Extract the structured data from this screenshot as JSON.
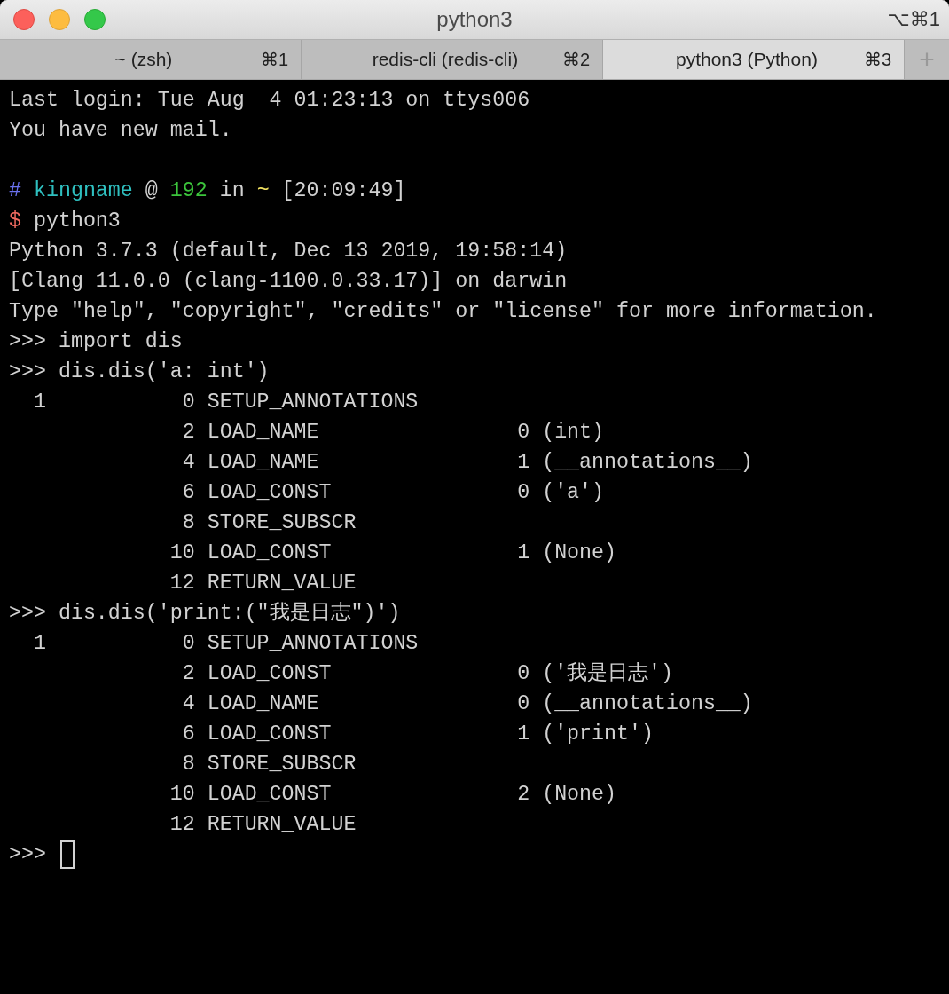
{
  "window": {
    "title": "python3",
    "shortcut": "⌥⌘1"
  },
  "tabs": [
    {
      "label": "~ (zsh)",
      "shortcut": "⌘1",
      "selected": false
    },
    {
      "label": "redis-cli (redis-cli)",
      "shortcut": "⌘2",
      "selected": false
    },
    {
      "label": "python3 (Python)",
      "shortcut": "⌘3",
      "selected": true
    }
  ],
  "new_tab_button": "+",
  "terminal": {
    "lines": [
      {
        "kind": "plain",
        "text": "Last login: Tue Aug  4 01:23:13 on ttys006"
      },
      {
        "kind": "plain",
        "text": "You have new mail."
      },
      {
        "kind": "blank"
      },
      {
        "kind": "colored",
        "segments": [
          {
            "text": "#",
            "color": "#6b72f0"
          },
          {
            "text": " kingname",
            "color": "#2fc0c0"
          },
          {
            "text": " @ "
          },
          {
            "text": "192",
            "color": "#3cc43c"
          },
          {
            "text": " in "
          },
          {
            "text": "~",
            "color": "#f0e060"
          },
          {
            "text": " [20:09:49]"
          }
        ]
      },
      {
        "kind": "colored",
        "segments": [
          {
            "text": "$",
            "color": "#f06a60"
          },
          {
            "text": " python3"
          }
        ]
      },
      {
        "kind": "plain",
        "text": "Python 3.7.3 (default, Dec 13 2019, 19:58:14)"
      },
      {
        "kind": "plain",
        "text": "[Clang 11.0.0 (clang-1100.0.33.17)] on darwin"
      },
      {
        "kind": "plain",
        "text": "Type \"help\", \"copyright\", \"credits\" or \"license\" for more information."
      },
      {
        "kind": "plain",
        "text": ">>> import dis"
      },
      {
        "kind": "plain",
        "text": ">>> dis.dis('a: int')"
      },
      {
        "kind": "plain",
        "text": "  1           0 SETUP_ANNOTATIONS"
      },
      {
        "kind": "plain",
        "text": "              2 LOAD_NAME                0 (int)"
      },
      {
        "kind": "plain",
        "text": "              4 LOAD_NAME                1 (__annotations__)"
      },
      {
        "kind": "plain",
        "text": "              6 LOAD_CONST               0 ('a')"
      },
      {
        "kind": "plain",
        "text": "              8 STORE_SUBSCR"
      },
      {
        "kind": "plain",
        "text": "             10 LOAD_CONST               1 (None)"
      },
      {
        "kind": "plain",
        "text": "             12 RETURN_VALUE"
      },
      {
        "kind": "plain",
        "text": ">>> dis.dis('print:(\"我是日志\")')"
      },
      {
        "kind": "plain",
        "text": "  1           0 SETUP_ANNOTATIONS"
      },
      {
        "kind": "plain",
        "text": "              2 LOAD_CONST               0 ('我是日志')"
      },
      {
        "kind": "plain",
        "text": "              4 LOAD_NAME                0 (__annotations__)"
      },
      {
        "kind": "plain",
        "text": "              6 LOAD_CONST               1 ('print')"
      },
      {
        "kind": "plain",
        "text": "              8 STORE_SUBSCR"
      },
      {
        "kind": "plain",
        "text": "             10 LOAD_CONST               2 (None)"
      },
      {
        "kind": "plain",
        "text": "             12 RETURN_VALUE"
      },
      {
        "kind": "input",
        "text": ">>> ",
        "cursor": true
      }
    ]
  }
}
